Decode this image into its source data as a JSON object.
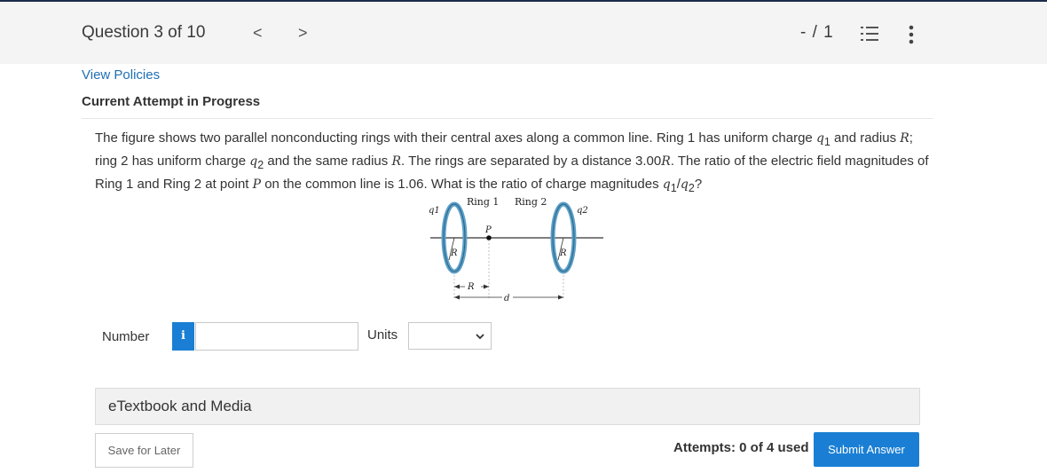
{
  "header": {
    "question_label": "Question 3 of 10",
    "prev_glyph": "<",
    "next_glyph": ">",
    "score": "- / 1"
  },
  "links": {
    "view_policies": "View Policies"
  },
  "status": {
    "attempt_heading": "Current Attempt in Progress"
  },
  "question": {
    "t1": "The figure shows two parallel nonconducting rings with their central axes along a common line. Ring 1 has uniform charge ",
    "q1": "q",
    "q1sub": "1",
    "t2": " and radius ",
    "R1": "R",
    "t3": "; ring 2 has uniform charge ",
    "q2": "q",
    "q2sub": "2",
    "t4": " and the same radius ",
    "R2": "R",
    "t5": ". The rings are separated by a distance 3.00",
    "R3": "R",
    "t6": ". The ratio of the electric field magnitudes of Ring 1 and Ring 2 at point ",
    "P": "P",
    "t7": " on the common line is 1.06. What is the ratio of charge magnitudes ",
    "r_q1": "q",
    "r_q1sub": "1",
    "slash": "/",
    "r_q2": "q",
    "r_q2sub": "2",
    "t8": "?"
  },
  "figure": {
    "ring1_label": "Ring 1",
    "ring2_label": "Ring 2",
    "q1_label": "q1",
    "q2_label": "q2",
    "p_label": "P",
    "r_label": "R",
    "r_dim_label": "R",
    "d_label": "d",
    "ring_color": "#5aa0c8"
  },
  "answer": {
    "number_label": "Number",
    "info_glyph": "i",
    "number_value": "",
    "units_label": "Units",
    "units_selected": ""
  },
  "etextbook": {
    "label": "eTextbook and Media"
  },
  "footer": {
    "save_label": "Save for Later",
    "attempts_text": "Attempts: 0 of 4 used",
    "submit_label": "Submit Answer"
  },
  "colors": {
    "accent": "#1a7fd4",
    "link": "#1f6fb4",
    "header_bg": "#f4f4f4"
  },
  "icons": [
    "chevron-left-icon",
    "chevron-right-icon",
    "numbered-list-icon",
    "more-vertical-icon",
    "info-icon",
    "chevron-down-icon"
  ]
}
